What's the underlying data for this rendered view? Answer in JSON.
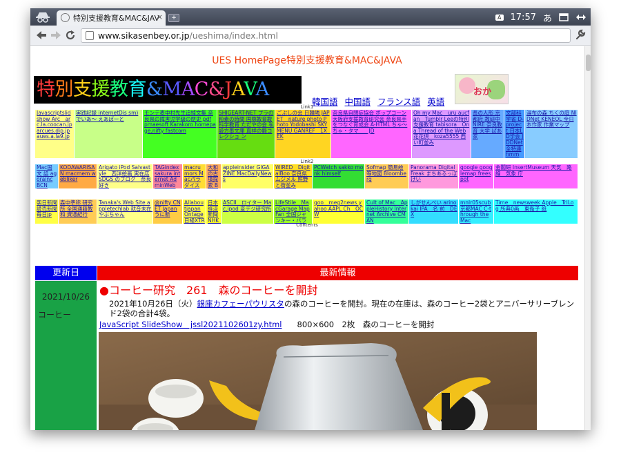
{
  "browser": {
    "tab_title": "特別支援教育&MAC&JAV",
    "tab_close": "×",
    "new_tab": "+",
    "tray": {
      "kbd": "A",
      "time": "17:57",
      "ime": "あ"
    },
    "url_host": "www.sikasenbey.or.jp",
    "url_path": "/ueshima/index.html",
    "icons": [
      "incognito-icon",
      "back-icon",
      "forward-icon",
      "reload-icon",
      "page-icon",
      "wrench-icon"
    ]
  },
  "page": {
    "title": "UES HomePage特別支援教育&MAC&JAVA",
    "logo": [
      {
        "t": "特",
        "c": "#ff3b3b"
      },
      {
        "t": "別",
        "c": "#ff7d1a"
      },
      {
        "t": "支",
        "c": "#ffd21a"
      },
      {
        "t": "援",
        "c": "#8cff1a"
      },
      {
        "t": "教",
        "c": "#1aff7d"
      },
      {
        "t": "育",
        "c": "#1affff"
      },
      {
        "t": "&",
        "c": "#3b8cff"
      },
      {
        "t": "M",
        "c": "#5a5aff"
      },
      {
        "t": "A",
        "c": "#a14bff"
      },
      {
        "t": "C",
        "c": "#ff4bd8"
      },
      {
        "t": "&",
        "c": "#ff4b8c"
      },
      {
        "t": "J",
        "c": "#ff3b3b"
      },
      {
        "t": "A",
        "c": "#ffd21a"
      },
      {
        "t": "V",
        "c": "#1aff7d"
      },
      {
        "t": "A",
        "c": "#3b8cff"
      }
    ],
    "languages": [
      "韓国語",
      "中国語",
      "フランス語",
      "英語"
    ],
    "picture_text": "おか",
    "link1_label": "Link1",
    "link2_label": "Link2",
    "contents_label": "Contents",
    "link1_cells": [
      {
        "bg": "#ffff88",
        "text": "Javascriptslidshow Arc　arc.la.coocan.jp arcues.dip.jp aues.a.la9.jp"
      },
      {
        "bg": "#c8ff88",
        "text": "実践記録 internetDis sm) でいあ～ えあぽーと"
      },
      {
        "bg": "#44ff22",
        "text": "モンテ麦中村先生追悼文集 奈良県の障害児学級の歴史 pdf pmaesoft Karakoro homepage.nifty fastcom"
      },
      {
        "bg": "#66dd11",
        "text": "SHIGEART-NET プラの粉素の時間 国際教育教科学教育 ただやの会 私設方墨文庫 真祥の鍛コレクショ ン"
      },
      {
        "bg": "#ffd522",
        "text": "ごぶしの会 日韓隣 JAPET　nature photo Photo Yodobashi SKYMENU GANREF　1X　EK"
      },
      {
        "bg": "#ff66ff",
        "text": "奈良県自閉症協会 ポップコーン 大阪府支援教育研究会 奈良県手をつなぐ育成会 A-HTML ちゃ～ちゃ・タマ　　JD"
      },
      {
        "bg": "#dd99ff",
        "text": "Oh my Mac　uru aucfan　Tumblr Leeの特別支援教育 tabisora　On a Thread of the Web 花花倶　koza5555 西い町並み"
      },
      {
        "bg": "#66aaff",
        "text": "長の人形 京都府 教研中 NIRE 奈良教育 大学 ばあ家"
      },
      {
        "bg": "#4499ff",
        "text": "文部科学省 D-project 日本LD学会 JDDNet 全特連 hmmmlog"
      },
      {
        "bg": "#88ccff",
        "text": "湯布の森 ちくの庭 NIDNet KENEOL 全日本作家 作業マップ"
      }
    ],
    "link2_cells": [
      {
        "bg": "#77ccff",
        "text": "Mac国文 話 agorainc BCN"
      },
      {
        "bg": "#ffaa44",
        "text": "KODAWARISAN macmem webliker"
      },
      {
        "bg": "#ffff88",
        "text": "Arigato iPod Salvastyle　西洋絵画 実在店 SDGS のブログ　奈良好き"
      },
      {
        "bg": "#ff8899",
        "text": "TAGindex sakura internet AdminWeb"
      },
      {
        "bg": "#ffdd33",
        "text": "macrumors Macパラダイス くまめくり"
      },
      {
        "bg": "#ffaa55",
        "text": "大和の古墳探索 Babletech itea40　UAG美術家 研究所"
      },
      {
        "bg": "#ffff66",
        "text": "appleinsider GIGAZINE MacDailyNews"
      },
      {
        "bg": "#ffdd22",
        "text": "WIRED　DigitalBoo 奈良県　ムジメル 熊野と街並み"
      },
      {
        "bg": "#33dd33",
        "text": "PCWatch sakko monk himself"
      },
      {
        "bg": "#ffcc55",
        "text": "Sofmap 簡易絵等地図 Bloomberg"
      },
      {
        "bg": "#ff99dd",
        "text": "Panorama DigitalFreak まちあるっぽ けい"
      },
      {
        "bg": "#ff66ff",
        "text": "google googlemap freespot"
      },
      {
        "bg": "#ff66ff",
        "text": "金閣研 InsertMuseum 天気　路線　気象 庁"
      }
    ],
    "contents_cells": [
      {
        "bg": "#ffff44",
        "text": "朝日新聞 読売新聞 毎日jp"
      },
      {
        "bg": "#ffcc55",
        "text": "森中準称 研究 所 全国通籍教和 資通紀行"
      },
      {
        "bg": "#ffff88",
        "text": "Tanaka's Web Site appletechlab 就音未在　やぶちゃん"
      },
      {
        "bg": "#ffcc44",
        "text": "@nifty CNET Japan うに新"
      },
      {
        "bg": "#ffff44",
        "text": "Allaboutjapan Ontage 日経XTREND"
      },
      {
        "bg": "#ffff22",
        "text": "日本経済新聞 NHK　NHKnara artscape　IMA"
      },
      {
        "bg": "#ccff44",
        "text": "ASCII　ロイター Mac.ipod 変デジ研究所"
      },
      {
        "bg": "#99ff22",
        "text": "LifeStile　MacGarage MapFan 全国ジャンキー・パラ ダイス"
      },
      {
        "bg": "#ffff33",
        "text": "goo　meg2news yahoo AAPL Ch　OCW"
      },
      {
        "bg": "#33ff99",
        "text": "Cult of Mac　AppleHistory Internet Archive CMAN"
      },
      {
        "bg": "#33ddff",
        "text": "しがせんべい arinokai IPA　名 前　DEX"
      },
      {
        "bg": "#33eeff",
        "text": "mnlr05scub 京都MAC C-through the Mac"
      },
      {
        "bg": "#33ffff",
        "text": "Time　newsweek Apple　TriLog 所典0画　東衛子 紙"
      }
    ],
    "table_header": {
      "date": "更新日",
      "news": "最新情報"
    },
    "entry": {
      "date": "2021/10/26",
      "category": "コーヒー",
      "title": "●コーヒー研究　261　森のコーヒーを開封",
      "body_prefix": "2021年10月26日（火）",
      "body_link": "銀座カフェーパウリスタ",
      "body_suffix": "の森のコーヒーを開封。現在の在庫は、森のコーヒー2袋とアニバーサリーブレンド2袋の合計4袋。",
      "slide_link": "JavaScript SlideShow　jssl2021102601zy.html",
      "slide_info": "800×600　2枚　森のコーヒーを開封"
    }
  }
}
